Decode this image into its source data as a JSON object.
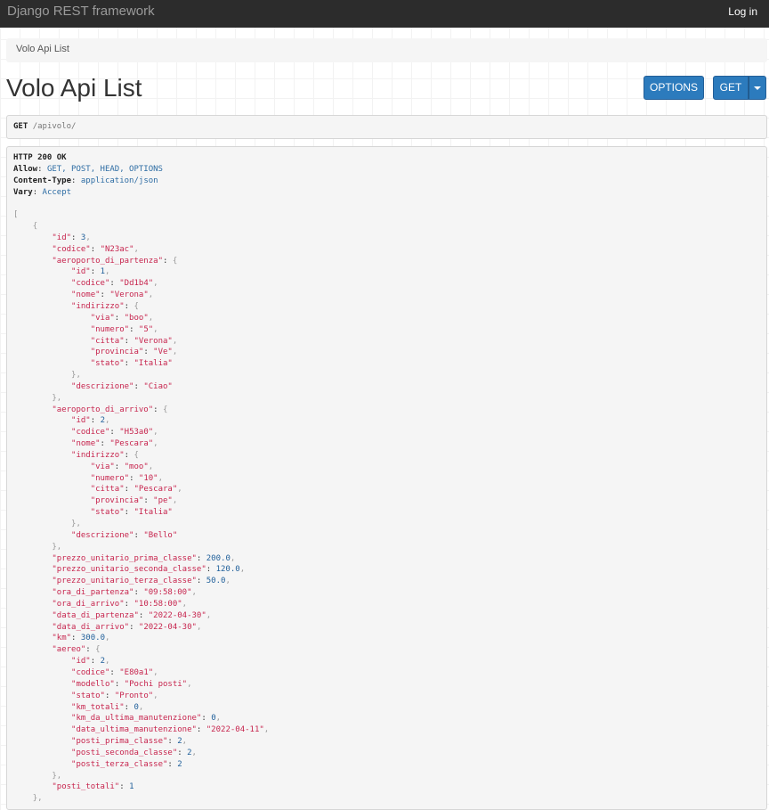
{
  "navbar": {
    "brand": "Django REST framework",
    "login": "Log in"
  },
  "breadcrumb": {
    "current": "Volo Api List"
  },
  "page": {
    "title": "Volo Api List"
  },
  "buttons": {
    "options": "OPTIONS",
    "get": "GET"
  },
  "request": {
    "method": "GET",
    "path": "/apivolo/"
  },
  "response": {
    "status": "HTTP 200 OK",
    "headers": [
      {
        "key": "Allow",
        "value": "GET, POST, HEAD, OPTIONS"
      },
      {
        "key": "Content-Type",
        "value": "application/json"
      },
      {
        "key": "Vary",
        "value": "Accept"
      }
    ],
    "body": [
      {
        "id": 3,
        "codice": "N23ac",
        "aeroporto_di_partenza": {
          "id": 1,
          "codice": "Dd1b4",
          "nome": "Verona",
          "indirizzo": {
            "via": "boo",
            "numero": "5",
            "citta": "Verona",
            "provincia": "Ve",
            "stato": "Italia"
          },
          "descrizione": "Ciao"
        },
        "aeroporto_di_arrivo": {
          "id": 2,
          "codice": "H53a0",
          "nome": "Pescara",
          "indirizzo": {
            "via": "moo",
            "numero": "10",
            "citta": "Pescara",
            "provincia": "pe",
            "stato": "Italia"
          },
          "descrizione": "Bello"
        },
        "prezzo_unitario_prima_classe": "200.0",
        "prezzo_unitario_seconda_classe": "120.0",
        "prezzo_unitario_terza_classe": "50.0",
        "ora_di_partenza": "09:58:00",
        "ora_di_arrivo": "10:58:00",
        "data_di_partenza": "2022-04-30",
        "data_di_arrivo": "2022-04-30",
        "km": "300.0",
        "aereo": {
          "id": 2,
          "codice": "E80a1",
          "modello": "Pochi posti",
          "stato": "Pronto",
          "km_totali": 0,
          "km_da_ultima_manutenzione": 0,
          "data_ultima_manutenzione": "2022-04-11",
          "posti_prima_classe": 2,
          "posti_seconda_classe": 2,
          "posti_terza_classe": 2
        },
        "posti_totali": 1
      }
    ]
  }
}
